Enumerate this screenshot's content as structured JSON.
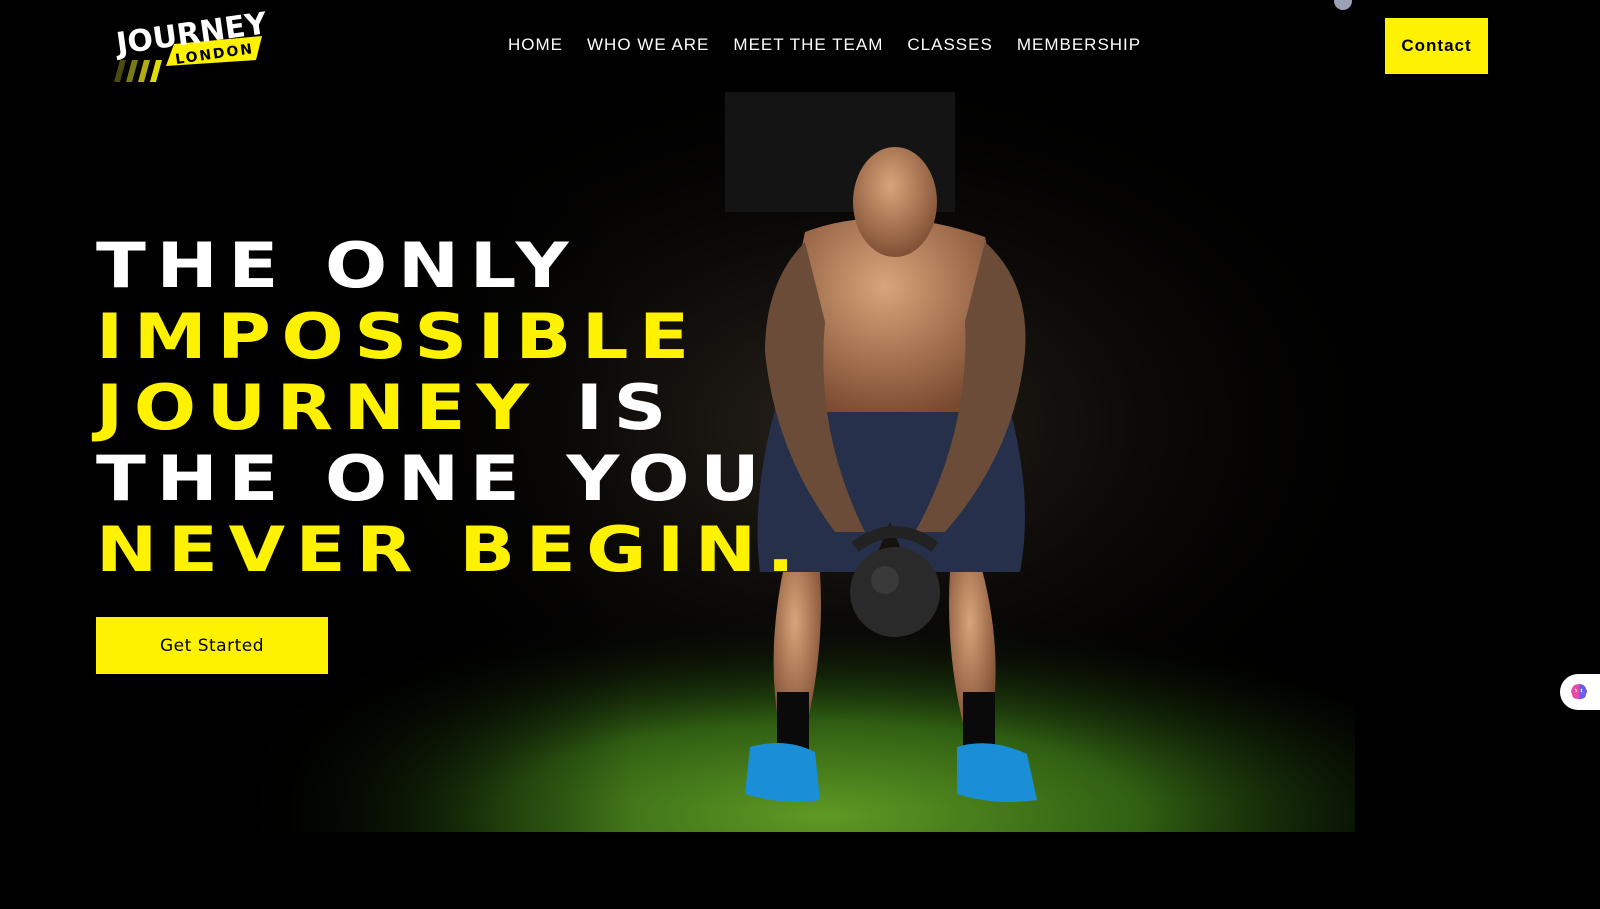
{
  "brand": {
    "logo_line1": "JOURNEY",
    "logo_line2": "LONDON",
    "accent_color": "#fff200"
  },
  "nav": {
    "items": [
      {
        "label": "HOME"
      },
      {
        "label": "WHO WE ARE"
      },
      {
        "label": "MEET THE TEAM"
      },
      {
        "label": "CLASSES"
      },
      {
        "label": "MEMBERSHIP"
      }
    ],
    "contact_label": "Contact"
  },
  "hero": {
    "line1": "THE ONLY",
    "line2": "IMPOSSIBLE",
    "line3_yellow": "JOURNEY",
    "line3_white": " IS",
    "line4": "THE ONE YOU",
    "line5": "NEVER BEGIN.",
    "cta_label": "Get Started",
    "photo_icon": "kettlebell-athlete-photo"
  },
  "widget": {
    "icon": "brain-icon"
  }
}
